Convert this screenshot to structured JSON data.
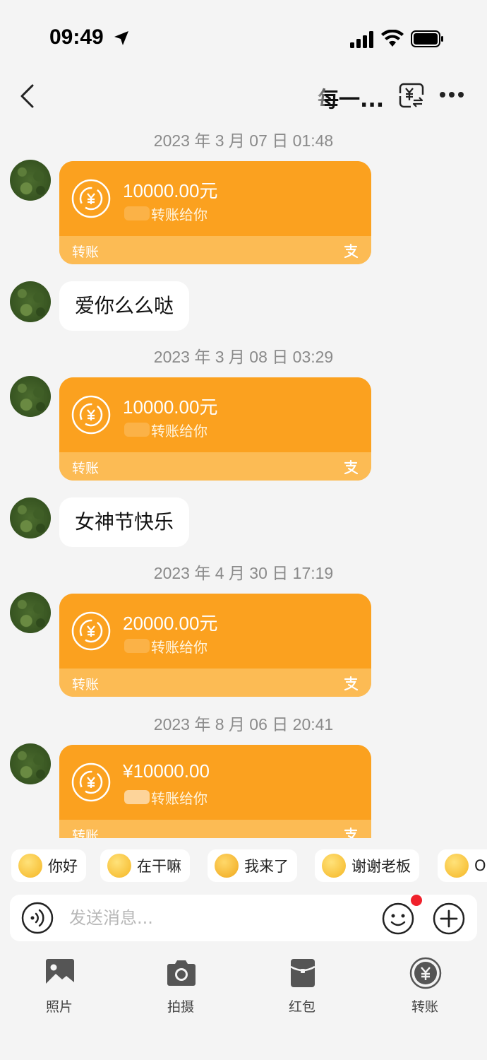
{
  "status_bar": {
    "time": "09:49"
  },
  "nav": {
    "title": "每一..."
  },
  "messages": {
    "ts1": "2023 年 3 月 07 日 01:48",
    "card1": {
      "amount": "10000.00元",
      "desc": "转账给你",
      "label": "转账"
    },
    "text1": "爱你么么哒",
    "ts2": "2023 年 3 月 08 日 03:29",
    "card2": {
      "amount": "10000.00元",
      "desc": "转账给你",
      "label": "转账"
    },
    "text2": "女神节快乐",
    "ts3": "2023 年 4 月 30 日 17:19",
    "card3": {
      "amount": "20000.00元",
      "desc": "转账给你",
      "label": "转账"
    },
    "ts4": "2023 年 8 月 06 日 20:41",
    "card4": {
      "amount": "¥10000.00",
      "desc": "转账给你",
      "label": "转账"
    }
  },
  "quick_replies": [
    "你好",
    "在干嘛",
    "我来了",
    "谢谢老板",
    "O"
  ],
  "input": {
    "placeholder": "发送消息..."
  },
  "toolbar": {
    "photo": "照片",
    "camera": "拍摄",
    "red_packet": "红包",
    "transfer": "转账"
  },
  "colors": {
    "card_orange": "#fba11f",
    "card_footer": "#fcbb54",
    "badge_red": "#f0212b"
  }
}
